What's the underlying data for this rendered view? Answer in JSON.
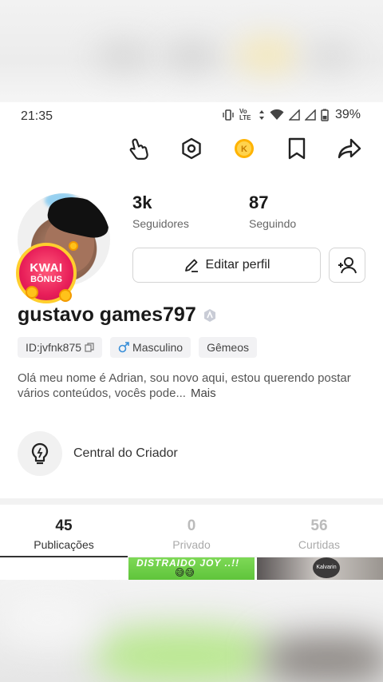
{
  "status_bar": {
    "time": "21:35",
    "network": "Vo LTE",
    "battery": "39%"
  },
  "toolbar": {
    "icons": [
      "hand-pointer-icon",
      "hexagon-settings-icon",
      "kwai-coin-icon",
      "bookmark-icon",
      "share-arrow-icon"
    ],
    "coin_glyph": "K"
  },
  "profile": {
    "badge_line1": "KWAI",
    "badge_line2": "BÔNUS",
    "followers_count": "3k",
    "followers_label": "Seguidores",
    "following_count": "87",
    "following_label": "Seguindo",
    "edit_label": "Editar perfil",
    "username": "gustavo games797",
    "id_tag": "ID:jvfnk875",
    "gender_tag": "Masculino",
    "sign_tag": "Gêmeos",
    "bio": "Olá meu nome é Adrian, sou novo aqui, estou querendo postar vários conteúdos, vocês pode...",
    "bio_more": "Mais",
    "creator_center": "Central do Criador"
  },
  "tabs": [
    {
      "count": "45",
      "label": "Publicações",
      "active": true
    },
    {
      "count": "0",
      "label": "Privado",
      "active": false
    },
    {
      "count": "56",
      "label": "Curtidas",
      "active": false
    }
  ],
  "thumbnails": {
    "thumb2_text": "DISTRAIDO JOY ..!!",
    "thumb2_emoji": "😅😅",
    "thumb3_text": "Kalvarin"
  },
  "colors": {
    "accent": "#e81e59",
    "badge_ring": "#ffcf2e",
    "coin": "#ffc21a",
    "gender_blue": "#3a8fd8"
  }
}
